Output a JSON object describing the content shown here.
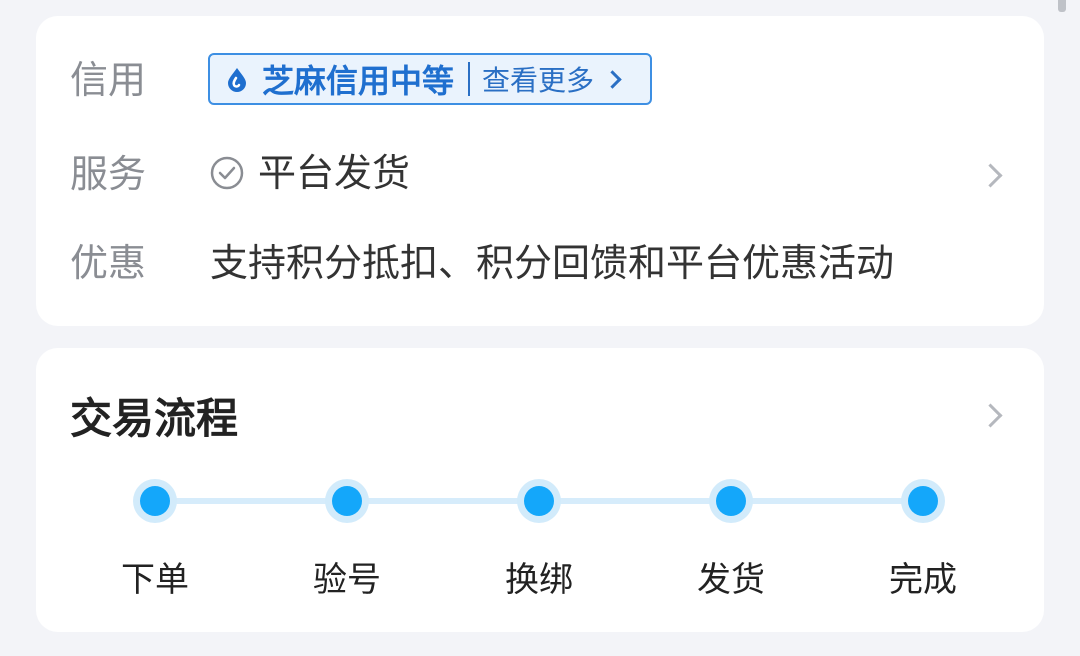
{
  "info": {
    "credit": {
      "label": "信用",
      "badge_text": "芝麻信用中等",
      "more_text": "查看更多"
    },
    "service": {
      "label": "服务",
      "value": "平台发货"
    },
    "promo": {
      "label": "优惠",
      "value": "支持积分抵扣、积分回馈和平台优惠活动"
    }
  },
  "process": {
    "title": "交易流程",
    "steps": [
      "下单",
      "验号",
      "换绑",
      "发货",
      "完成"
    ]
  },
  "colors": {
    "accent": "#14a7fa",
    "badge_blue": "#1f6fcf"
  },
  "icons": {
    "credit": "water-drop-icon",
    "service": "check-circle-icon"
  }
}
